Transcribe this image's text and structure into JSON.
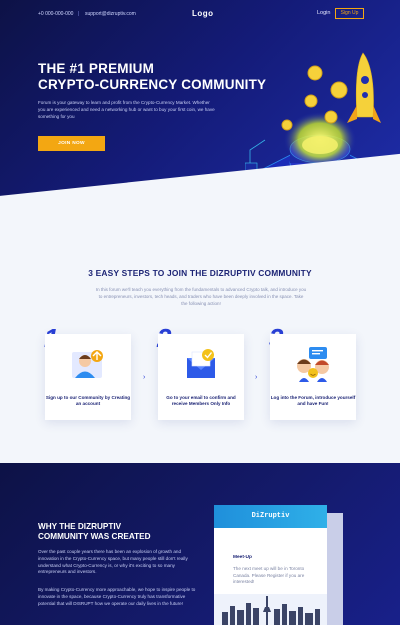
{
  "topbar": {
    "phone": "+0 000-000-000",
    "separator": "|",
    "email": "support@dizruptiv.com",
    "logo": "Logo",
    "login": "Login",
    "signup": "Sign Up"
  },
  "hero": {
    "title_line1": "THE #1 PREMIUM",
    "title_line2": "CRYPTO-CURRENCY COMMUNITY",
    "description": "Forum is your gateway to learn and profit from the Crypto-Currency Market. Whether you are experienced and need a networking hub or want to buy your first coin, we have something for you",
    "cta": "JOIN NOW"
  },
  "steps": {
    "title": "3 EASY STEPS TO JOIN THE DIZRUPTIV COMMUNITY",
    "description": "In this forum we'll teach you everything from the fundamentals to advanced Crypto talk, and introduce you to entrepreneurs, investors, tech heads, and traders who have been deeply involved in the space. Take the following action!",
    "items": [
      {
        "number": "1",
        "text": "Sign up to our Community by Creating an account"
      },
      {
        "number": "2",
        "text": "Go to your email to confirm and receive Members Only Info"
      },
      {
        "number": "3",
        "text": "Log into the Forum, introduce yourself and have Fun!"
      }
    ],
    "arrow": "›"
  },
  "why": {
    "title_line1": "WHY THE DIZRUPTIV",
    "title_line2": "COMMUNITY WAS CREATED",
    "paragraph1": "Over the past couple years there has been an explosion of growth and innovation in the Crypto-Currency space, but many people still don't really understand what Crypto-Currency is, or why it's exciting to so many entrepreneurs and investors.",
    "paragraph2": "By making Crypto-Currency more approachable, we hope to inspire people to innovate in the space, because Crypto-Currency truly has transformative potential that will DISRUPT how we operate our daily lives in the future!",
    "card": {
      "brand": "DiZruptiv",
      "heading": "Meet-Up",
      "text": "The next meet up will be in Toronto Canada. Please Register if you are interested!"
    }
  },
  "colors": {
    "accent": "#f3a712",
    "navy": "#1c2475",
    "blue": "#2940d6"
  }
}
